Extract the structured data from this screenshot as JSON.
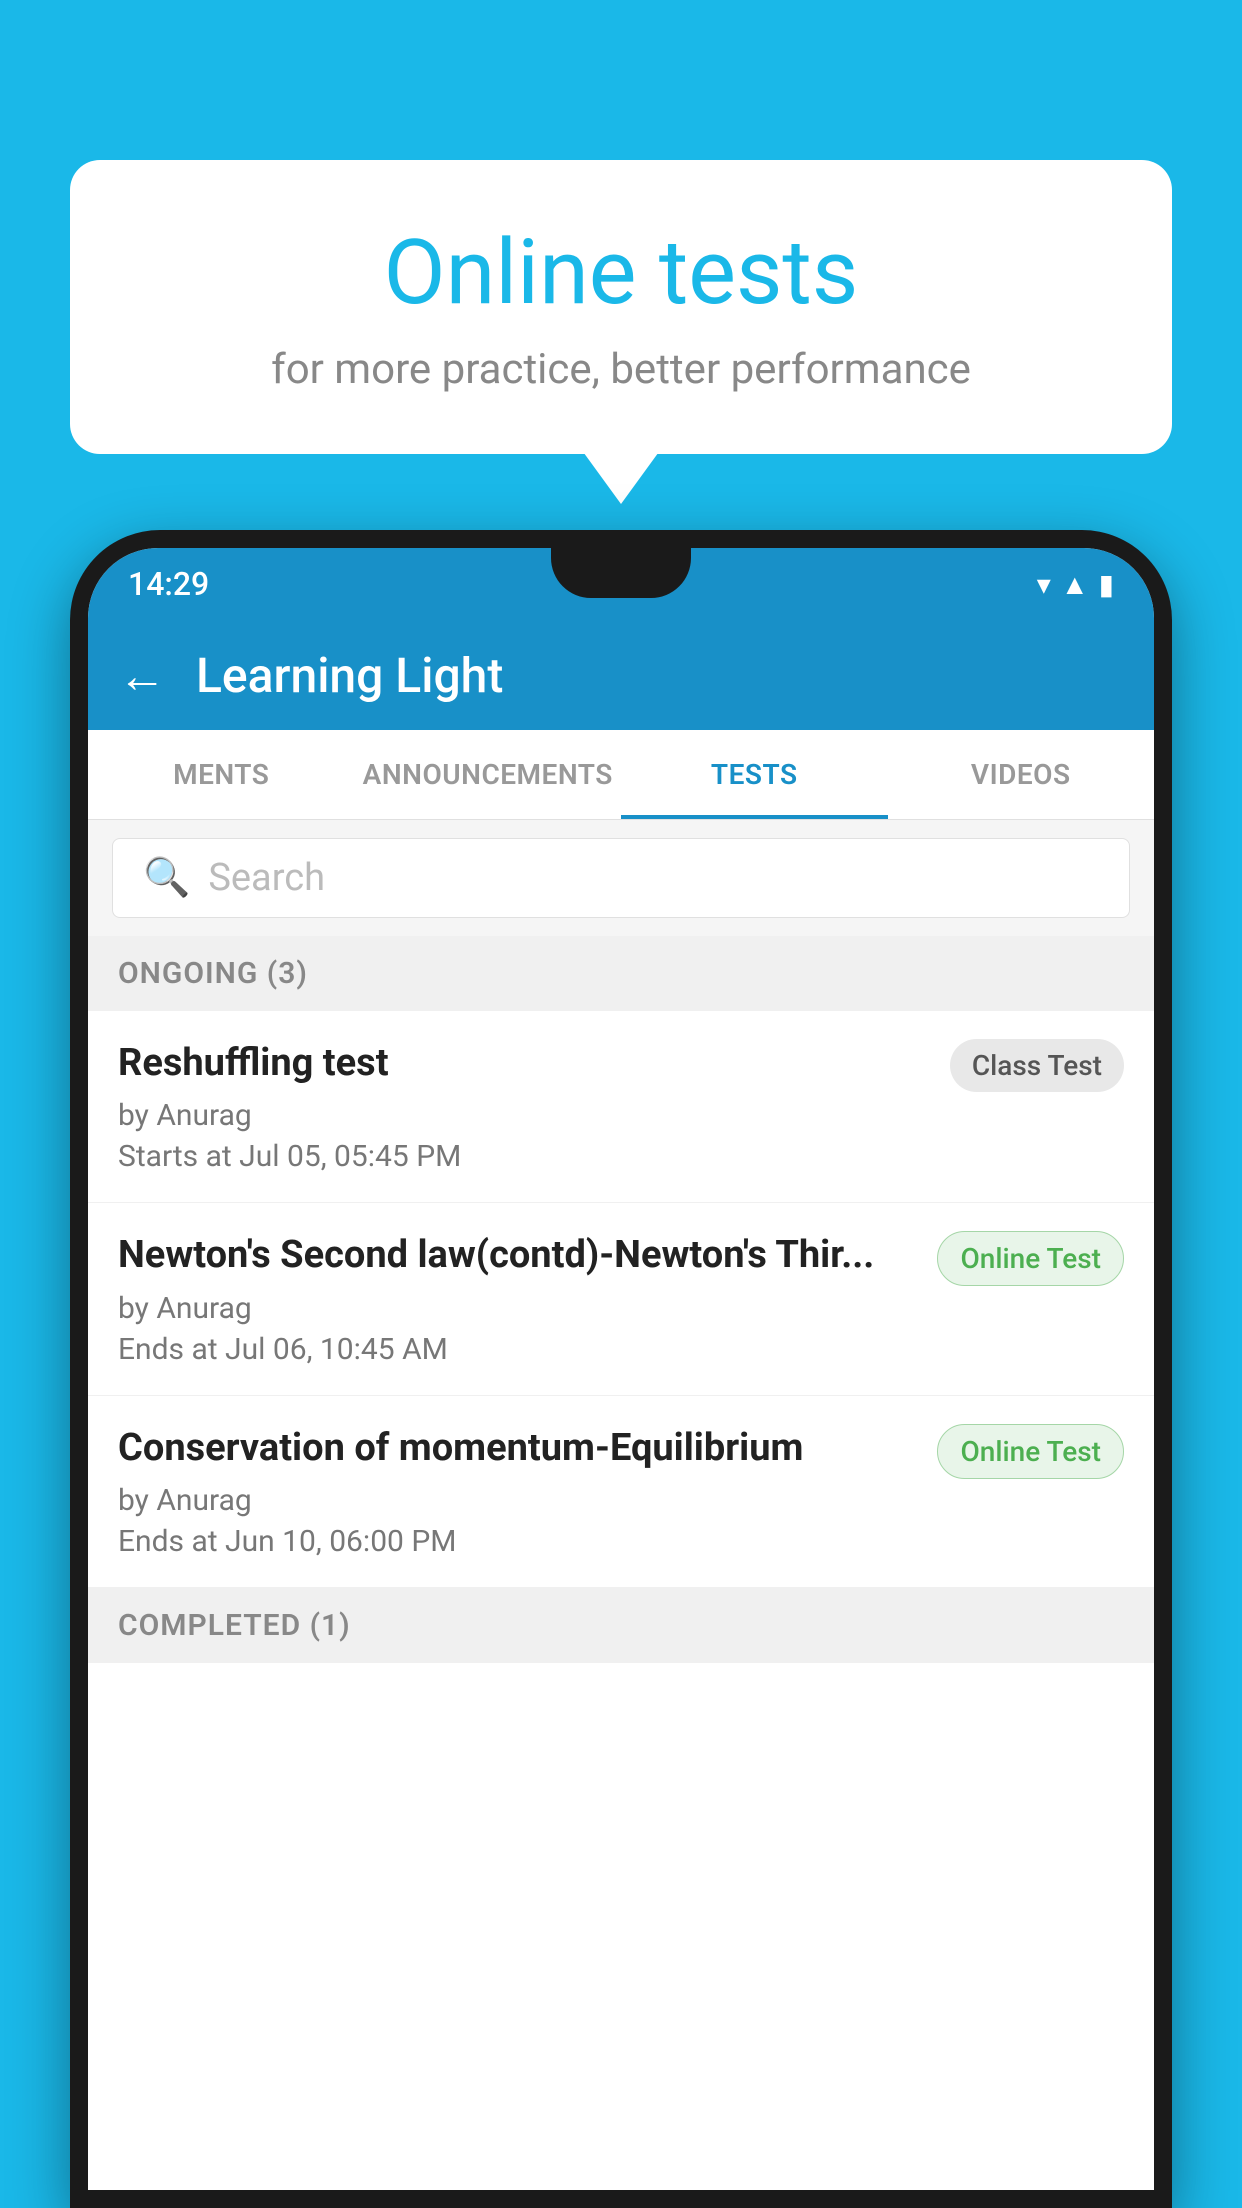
{
  "background_color": "#1ab8e8",
  "speech_bubble": {
    "title": "Online tests",
    "subtitle": "for more practice, better performance"
  },
  "status_bar": {
    "time": "14:29",
    "icons": [
      "wifi",
      "signal",
      "battery"
    ]
  },
  "app_bar": {
    "title": "Learning Light",
    "back_label": "←"
  },
  "tabs": [
    {
      "label": "MENTS",
      "active": false
    },
    {
      "label": "ANNOUNCEMENTS",
      "active": false
    },
    {
      "label": "TESTS",
      "active": true
    },
    {
      "label": "VIDEOS",
      "active": false
    }
  ],
  "search": {
    "placeholder": "Search"
  },
  "ongoing_section": {
    "header": "ONGOING (3)",
    "items": [
      {
        "title": "Reshuffling test",
        "author": "by Anurag",
        "date": "Starts at  Jul 05, 05:45 PM",
        "badge": "Class Test",
        "badge_type": "class"
      },
      {
        "title": "Newton's Second law(contd)-Newton's Thir...",
        "author": "by Anurag",
        "date": "Ends at  Jul 06, 10:45 AM",
        "badge": "Online Test",
        "badge_type": "online"
      },
      {
        "title": "Conservation of momentum-Equilibrium",
        "author": "by Anurag",
        "date": "Ends at  Jun 10, 06:00 PM",
        "badge": "Online Test",
        "badge_type": "online"
      }
    ]
  },
  "completed_section": {
    "header": "COMPLETED (1)"
  }
}
